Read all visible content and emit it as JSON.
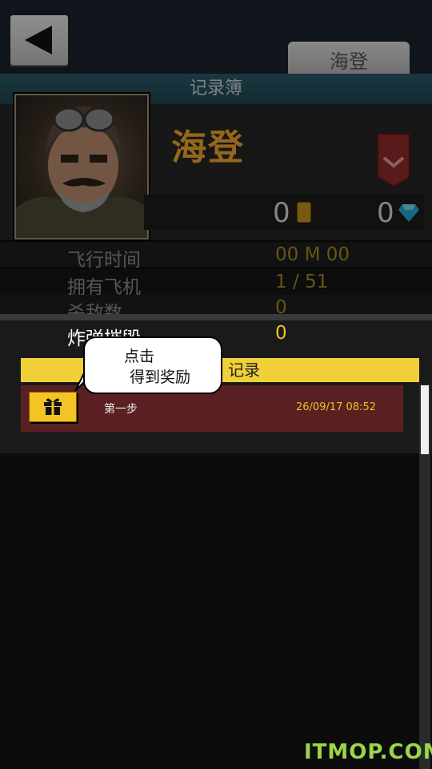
{
  "header": {
    "pilot_tab": "海登",
    "section_title": "记录簿"
  },
  "pilot": {
    "name": "海登",
    "coins": "0",
    "gems": "0"
  },
  "stats": [
    {
      "label": "飞行时间",
      "value": "00 M 00"
    },
    {
      "label": "拥有飞机",
      "value": "1 / 51"
    },
    {
      "label": "杀敌数",
      "value": "0"
    },
    {
      "label": "炸弹摧毁",
      "value": "0"
    }
  ],
  "records": {
    "header": "记录",
    "items": [
      {
        "title": "第一步",
        "date": "26/09/17 08:52"
      }
    ]
  },
  "tooltip": {
    "line1": "点击",
    "line2": "得到奖励"
  },
  "watermark": "ITMOP.COM",
  "colors": {
    "accent_gold": "#f0a62a",
    "value_yellow": "#e8c229",
    "record_bg": "#5a1f20",
    "title_band": "#2c5a68"
  }
}
